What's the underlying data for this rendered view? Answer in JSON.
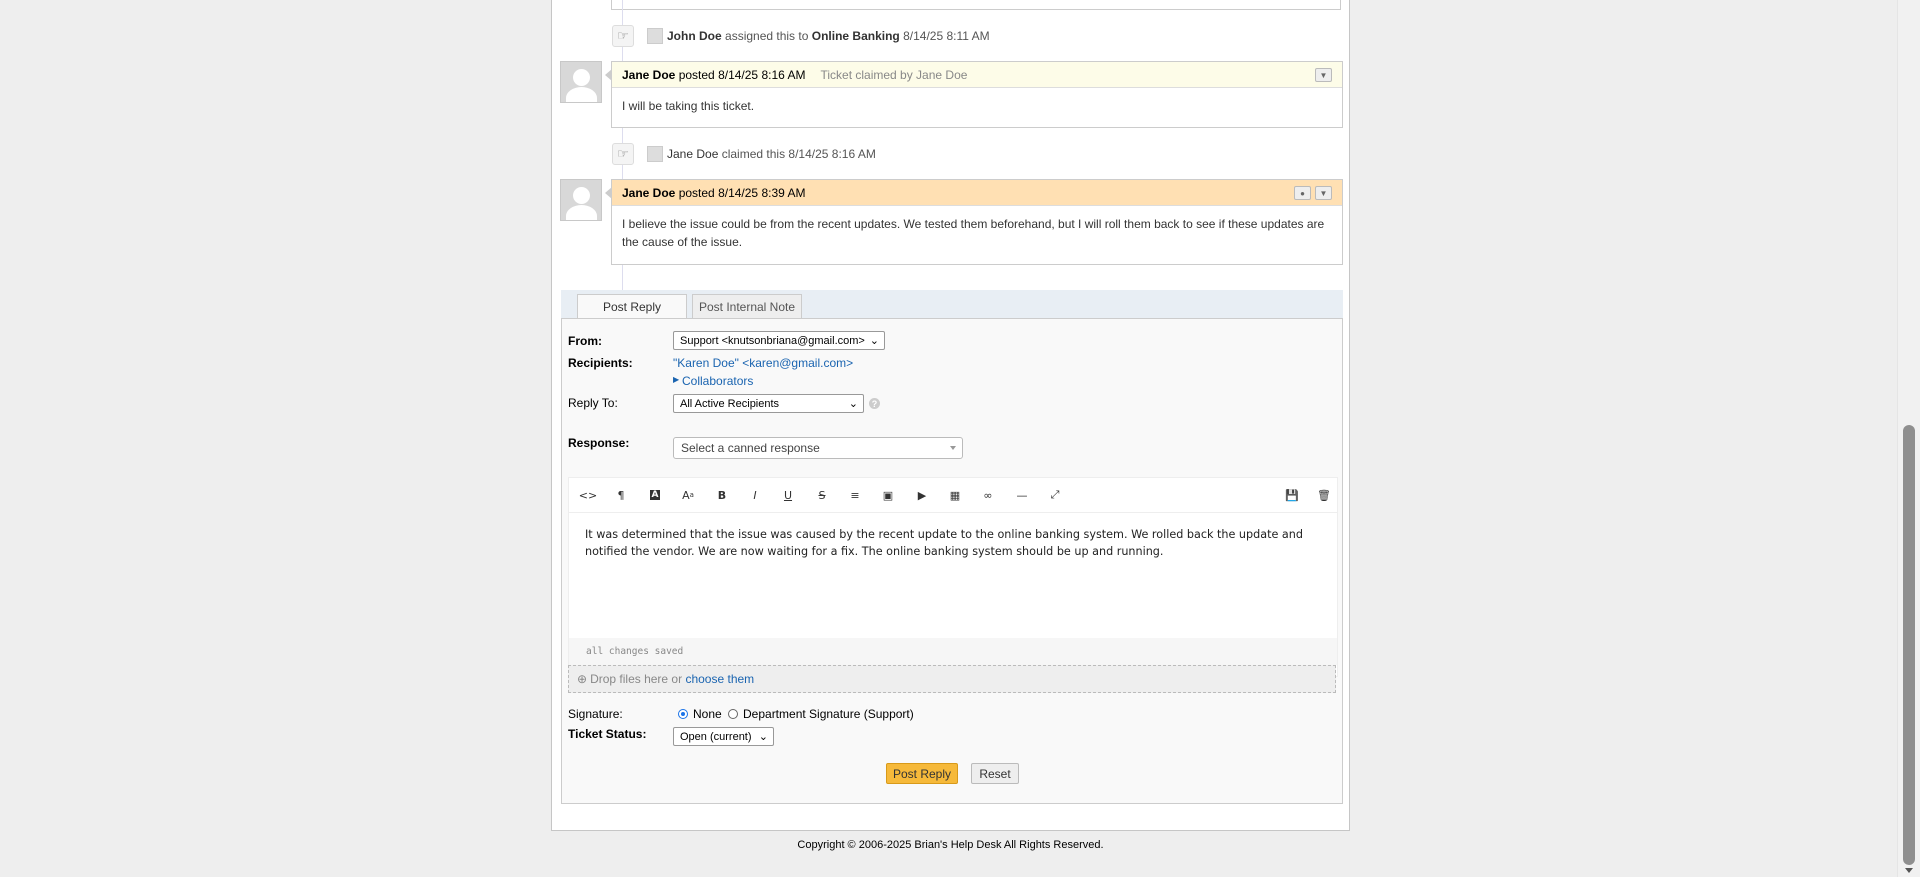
{
  "events": [
    {
      "user": "John Doe",
      "action": "assigned this to",
      "target": "Online Banking",
      "time": "8/14/25 8:11 AM"
    },
    {
      "user": "Jane Doe",
      "action": "claimed this",
      "time": "8/14/25 8:16 AM"
    }
  ],
  "entries": [
    {
      "author": "Jane Doe",
      "posted": "posted 8/14/25 8:16 AM",
      "note": "Ticket claimed by Jane Doe",
      "body": "I will be taking this ticket.",
      "header_color": "#fdfce8"
    },
    {
      "author": "Jane Doe",
      "posted": "posted 8/14/25 8:39 AM",
      "body": "I believe the issue could be from the recent updates. We tested them beforehand, but I will roll them back to see if these updates are the cause of the issue.",
      "header_color": "#ffe0b3"
    }
  ],
  "tabs": {
    "reply": "Post Reply",
    "note": "Post Internal Note"
  },
  "form": {
    "from_label": "From:",
    "from_value": "Support <knutsonbriana@gmail.com>",
    "recipients_label": "Recipients:",
    "recipient": "\"Karen Doe\" <karen@gmail.com>",
    "collaborators": "Collaborators",
    "reply_to_label": "Reply To:",
    "reply_to_value": "All Active Recipients",
    "response_label": "Response:",
    "canned_placeholder": "Select a canned response",
    "editor_text": "It was determined that the issue was caused by the recent update to the online banking system. We rolled back the update and notified the vendor. We are now waiting for a fix. The online banking system should be up and running.",
    "saved_status": "all changes saved",
    "drop_text": "Drop files here or",
    "drop_link": "choose them",
    "signature_label": "Signature:",
    "signature_none": "None",
    "signature_dept": "Department Signature (Support)",
    "status_label": "Ticket Status:",
    "status_value": "Open (current)",
    "post_button": "Post Reply",
    "reset_button": "Reset"
  },
  "toolbar_icons": [
    "code-view-icon",
    "paragraph-icon",
    "text-color-icon",
    "font-size-icon",
    "bold-icon",
    "italic-icon",
    "underline-icon",
    "strikethrough-icon",
    "list-icon",
    "image-icon",
    "video-icon",
    "table-icon",
    "link-icon",
    "horizontal-rule-icon",
    "fullscreen-icon",
    "save-draft-icon",
    "delete-draft-icon"
  ],
  "footer": {
    "copyright": "Copyright © 2006-2025 Brian's Help Desk All Rights Reserved."
  }
}
